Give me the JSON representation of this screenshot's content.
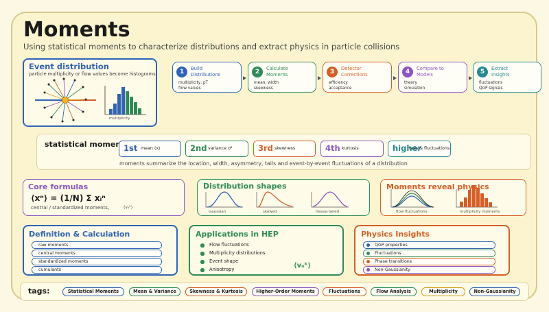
{
  "title": "Moments",
  "subtitle": "Using statistical moments to characterize distributions and extract physics in particle collisions",
  "event": {
    "title": "Event distribution",
    "desc": "particle multiplicity or flow values become histograms",
    "hist_label": "multiplicity"
  },
  "steps": [
    {
      "num": "1",
      "label": "Build\nDistributions",
      "detail": "multiplicity, pT\nflow values",
      "color": "#2f63b5"
    },
    {
      "num": "2",
      "label": "Calculate\nMoments",
      "detail": "mean, width\nskewness",
      "color": "#2e8b57"
    },
    {
      "num": "3",
      "label": "Detector\nCorrections",
      "detail": "efficiency\nacceptance",
      "color": "#d45f27"
    },
    {
      "num": "4",
      "label": "Compare to\nModels",
      "detail": "theory\nsimulation",
      "color": "#8a55c0"
    },
    {
      "num": "5",
      "label": "Extract\nInsights",
      "detail": "fluctuations\nQGP signals",
      "color": "#268a92"
    }
  ],
  "stat": {
    "label": "statistical moments",
    "orders": [
      {
        "order": "1st",
        "desc": "mean ⟨x⟩",
        "color": "#2f63b5"
      },
      {
        "order": "2nd",
        "desc": "variance σ²",
        "color": "#2e8b57"
      },
      {
        "order": "3rd",
        "desc": "skewness",
        "color": "#d45f27"
      },
      {
        "order": "4th",
        "desc": "kurtosis",
        "color": "#8a55c0"
      },
      {
        "order": "higher",
        "desc": "tails & fluctuations",
        "color": "#268a92"
      }
    ],
    "summary": "moments summarize the location, width, asymmetry, tails and event-by-event fluctuations of a distribution"
  },
  "formulas": {
    "title": "Core formulas",
    "formula": "⟨xⁿ⟩ = (1/N) Σ xᵢⁿ",
    "note": "central / standardized moments,",
    "note_symbol": "⟨vₙᵏ⟩"
  },
  "shapes": {
    "title": "Distribution shapes",
    "items": [
      "Gaussian",
      "skewed",
      "heavy-tailed"
    ]
  },
  "reveal": {
    "title": "Moments reveal physics",
    "items": [
      "flow fluctuations",
      "multiplicity moments"
    ]
  },
  "definition": {
    "title": "Definition & Calculation",
    "items": [
      "raw moments",
      "central moments",
      "standardized moments",
      "cumulants"
    ]
  },
  "applications": {
    "title": "Applications in HEP",
    "items": [
      "Flow fluctuations",
      "Multiplicity distributions",
      "Event shape",
      "Anisotropy"
    ],
    "symbol": "⟨vₙᵏ⟩"
  },
  "insights": {
    "title": "Physics Insights",
    "items": [
      {
        "label": "QGP properties",
        "color": "#2f63b5"
      },
      {
        "label": "Fluctuations",
        "color": "#2e8b57"
      },
      {
        "label": "Phase transitions",
        "color": "#d45f27"
      },
      {
        "label": "Non-Gaussianity",
        "color": "#8a55c0"
      }
    ]
  },
  "tags": {
    "label": "tags:",
    "items": [
      {
        "label": "Statistical Moments",
        "color": "#2f63b5"
      },
      {
        "label": "Mean & Variance",
        "color": "#2e8b57"
      },
      {
        "label": "Skewness & Kurtosis",
        "color": "#d45f27"
      },
      {
        "label": "Higher-Order Moments",
        "color": "#8a55c0"
      },
      {
        "label": "Fluctuations",
        "color": "#d45f27"
      },
      {
        "label": "Flow Analysis",
        "color": "#2e8b57"
      },
      {
        "label": "Multiplicity",
        "color": "#d4a017"
      },
      {
        "label": "Non-Gaussianity",
        "color": "#2f63b5"
      }
    ]
  }
}
